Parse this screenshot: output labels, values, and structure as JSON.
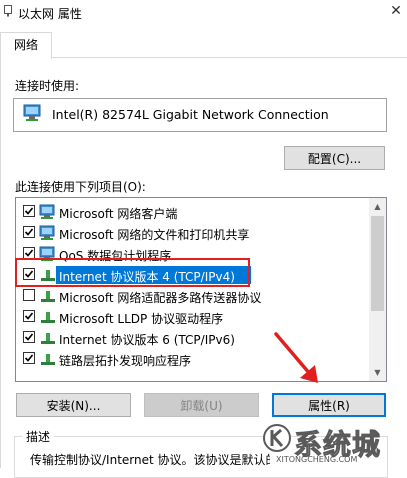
{
  "window": {
    "title": "以太网 属性"
  },
  "tabs": [
    {
      "label": "网络"
    }
  ],
  "connect_using": {
    "label": "连接时使用:",
    "adapter": "Intel(R) 82574L Gigabit Network Connection",
    "configure_button": "配置(C)..."
  },
  "items_section": {
    "label": "此连接使用下列项目(O):",
    "items": [
      {
        "label": "Microsoft 网络客户端",
        "checked": true,
        "icon": "network-client-icon"
      },
      {
        "label": "Microsoft 网络的文件和打印机共享",
        "checked": true,
        "icon": "file-printer-sharing-icon"
      },
      {
        "label": "QoS 数据包计划程序",
        "checked": true,
        "icon": "qos-icon"
      },
      {
        "label": "Internet 协议版本 4 (TCP/IPv4)",
        "checked": true,
        "selected": true,
        "icon": "protocol-icon"
      },
      {
        "label": "Microsoft 网络适配器多路传送器协议",
        "checked": false,
        "icon": "protocol-icon"
      },
      {
        "label": "Microsoft LLDP 协议驱动程序",
        "checked": true,
        "icon": "protocol-icon"
      },
      {
        "label": "Internet 协议版本 6 (TCP/IPv6)",
        "checked": true,
        "icon": "protocol-icon"
      },
      {
        "label": "链路层拓扑发现响应程序",
        "checked": true,
        "icon": "protocol-icon"
      }
    ]
  },
  "buttons": {
    "install": "安装(N)...",
    "uninstall": "卸载(U)",
    "properties": "属性(R)"
  },
  "description": {
    "title": "描述",
    "text": "传输控制协议/Internet 协议。该协议是默认的广域网络协议"
  },
  "watermark": {
    "text": "K 系统城",
    "url": "XITONGCHENG.COM"
  },
  "colors": {
    "selection": "#0078d7",
    "highlight_annotation": "#e02020",
    "arrow": "#e02020"
  }
}
